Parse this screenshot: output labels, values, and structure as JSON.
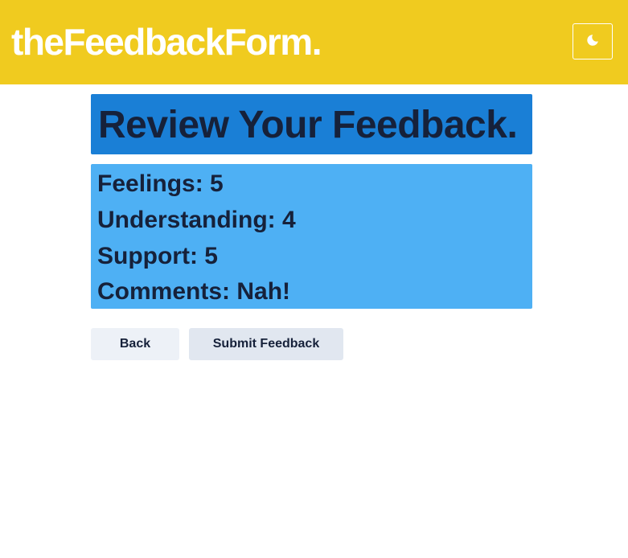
{
  "header": {
    "brand": "theFeedbackForm.",
    "theme_toggle_icon": "moon-icon"
  },
  "review": {
    "title": "Review Your Feedback.",
    "rows": [
      {
        "label": "Feelings",
        "value": "5",
        "text": "Feelings: 5"
      },
      {
        "label": "Understanding",
        "value": "4",
        "text": "Understanding: 4"
      },
      {
        "label": "Support",
        "value": "5",
        "text": "Support: 5"
      },
      {
        "label": "Comments",
        "value": "Nah!",
        "text": "Comments: Nah!"
      }
    ]
  },
  "actions": {
    "back_label": "Back",
    "submit_label": "Submit Feedback"
  },
  "colors": {
    "header_bg": "#f0cb1f",
    "title_bg": "#1a7fd6",
    "summary_bg": "#4eb0f4",
    "text_dark": "#16213a"
  }
}
